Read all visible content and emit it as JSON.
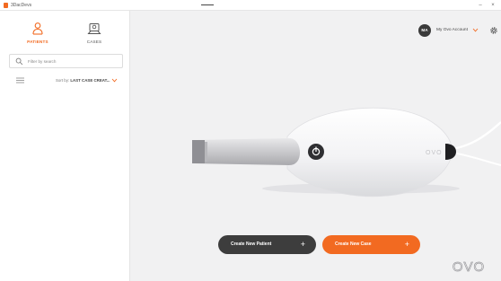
{
  "window": {
    "title": "3DacDevs",
    "minimize_symbol": "–",
    "close_symbol": "×"
  },
  "sidebar": {
    "tabs": [
      {
        "label": "PATIENTS",
        "icon": "patient-icon",
        "active": true
      },
      {
        "label": "CASES",
        "icon": "cases-icon",
        "active": false
      }
    ],
    "search": {
      "placeholder": "Filter by search",
      "value": ""
    },
    "sort": {
      "label": "Sort by:",
      "value": "LAST CASE CREAT..."
    }
  },
  "header": {
    "avatar_initials": "MA",
    "account_label": "My Ovo Account"
  },
  "actions": {
    "create_patient": "Create New Patient",
    "create_case": "Create New Case",
    "plus": "+"
  },
  "brand": {
    "logo_text": "OVO"
  },
  "colors": {
    "accent": "#f26a21",
    "dark_button": "#3d3d3d",
    "background": "#f1f1f2"
  }
}
